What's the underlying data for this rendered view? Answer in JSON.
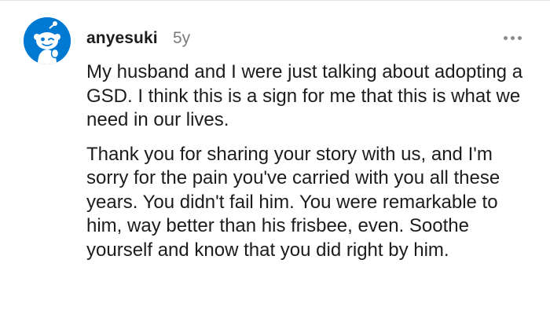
{
  "comment": {
    "username": "anyesuki",
    "age": "5y",
    "avatar_icon": "snoo-avatar-icon",
    "more_icon": "more-options-icon",
    "paragraphs": [
      "My husband and I were just talking about adopting a GSD. I think this is a sign for me that this is what we need in our lives.",
      "Thank you for sharing your story with us, and I'm sorry for the pain you've carried with you all these years. You didn't fail him. You were remarkable to him, way better than his frisbee, even. Soothe yourself and know that you did right by him."
    ]
  },
  "colors": {
    "avatar_background": "#0079d3",
    "username": "#1c1c1c",
    "age": "#7c7c7c",
    "text": "#1c1c1c"
  }
}
